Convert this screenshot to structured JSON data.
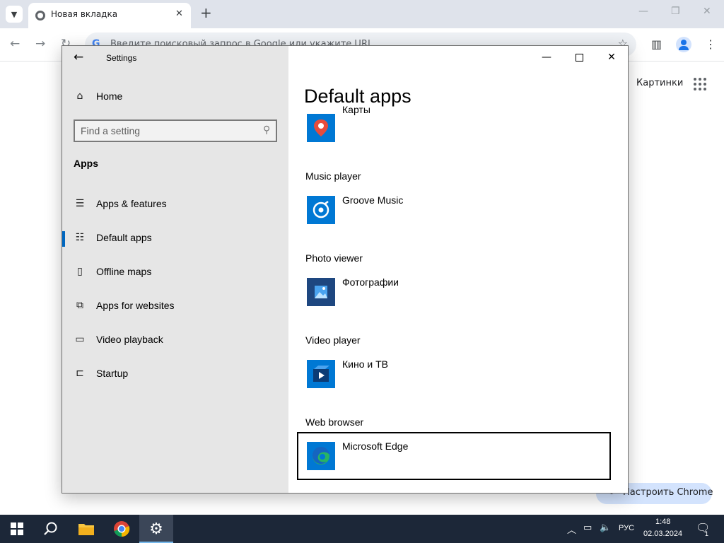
{
  "browser": {
    "tab_title": "Новая вкладка",
    "omnibox_placeholder": "Введите поисковый запрос в Google или укажите URL",
    "images_link": "Картинки",
    "customize_label": "Настроить Chrome"
  },
  "settings": {
    "window_title": "Settings",
    "nav": {
      "home_label": "Home",
      "search_placeholder": "Find a setting",
      "section_heading": "Apps",
      "items": [
        {
          "label": "Apps & features",
          "icon": "list-icon"
        },
        {
          "label": "Default apps",
          "icon": "default-apps-icon",
          "selected": true
        },
        {
          "label": "Offline maps",
          "icon": "map-icon"
        },
        {
          "label": "Apps for websites",
          "icon": "open-website-icon"
        },
        {
          "label": "Video playback",
          "icon": "video-camera-icon"
        },
        {
          "label": "Startup",
          "icon": "startup-icon"
        }
      ]
    },
    "content": {
      "page_title": "Default apps",
      "maps_app": "Карты",
      "sections": [
        {
          "category": "Music player",
          "app": "Groove Music"
        },
        {
          "category": "Photo viewer",
          "app": "Фотографии"
        },
        {
          "category": "Video player",
          "app": "Кино и ТВ"
        },
        {
          "category": "Web browser",
          "app": "Microsoft Edge"
        }
      ]
    },
    "colors": {
      "accent": "#0067c0",
      "nav_background": "#e6e6e6",
      "icon_blue": "#0078d4"
    }
  },
  "taskbar": {
    "language": "РУС",
    "time": "1:48",
    "date": "02.03.2024",
    "notification_count": "1"
  }
}
